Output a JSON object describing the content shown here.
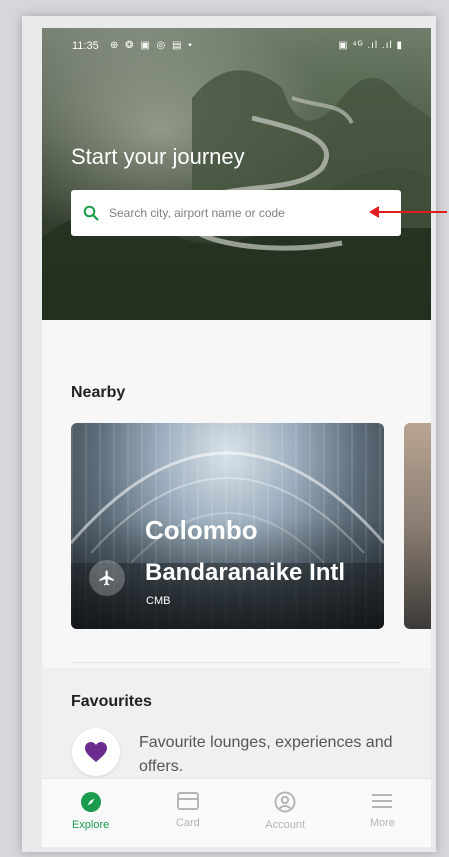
{
  "status": {
    "time": "11:35",
    "icons": "⊕ ❂ ▣ ◎ ▤ •",
    "right": "▣ ⁴ᴳ .ıl .ıl ▮"
  },
  "hero": {
    "title": "Start your journey"
  },
  "search": {
    "placeholder": "Search city, airport name or code"
  },
  "nearby": {
    "title": "Nearby",
    "card": {
      "city": "Colombo",
      "airport": "Bandaranaike Intl",
      "code": "CMB"
    }
  },
  "favourites": {
    "title": "Favourites",
    "text": "Favourite lounges, experiences and offers."
  },
  "nav": {
    "items": [
      {
        "label": "Explore",
        "icon": "compass-icon",
        "active": true
      },
      {
        "label": "Card",
        "icon": "card-icon",
        "active": false
      },
      {
        "label": "Account",
        "icon": "account-icon",
        "active": false
      },
      {
        "label": "More",
        "icon": "menu-icon",
        "active": false
      }
    ]
  },
  "colors": {
    "accent": "#1b9c4c",
    "heart": "#6b2c8f",
    "annotation_arrow": "#e01c1c"
  }
}
